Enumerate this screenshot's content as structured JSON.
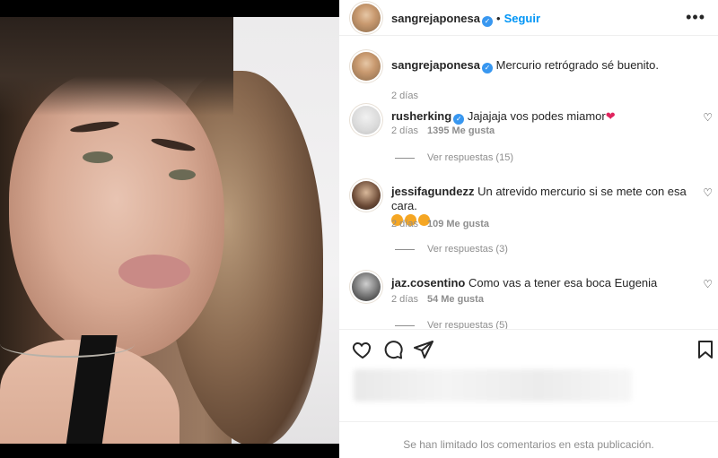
{
  "header": {
    "username": "sangrejaponesa",
    "separator": "•",
    "follow_label": "Seguir",
    "more_icon": "more-options-icon"
  },
  "caption": {
    "username": "sangrejaponesa",
    "text": "Mercurio retrógrado sé buenito.",
    "time": "2 días"
  },
  "comments": [
    {
      "username": "rusherking",
      "verified": true,
      "text": "Jajajaja vos podes miamor",
      "emoji": "red-heart",
      "time": "2 días",
      "likes": "1395 Me gusta",
      "replies": "Ver respuestas (15)"
    },
    {
      "username": "jessifagundezz",
      "verified": false,
      "text": "Un atrevido mercurio si se mete con esa cara.",
      "emoji": "heart-eyes x3",
      "time": "2 días",
      "likes": "109 Me gusta",
      "replies": "Ver respuestas (3)"
    },
    {
      "username": "jaz.cosentino",
      "verified": false,
      "text": "Como vas a tener esa boca Eugenia",
      "time": "2 días",
      "likes": "54 Me gusta",
      "replies": "Ver respuestas (5)"
    }
  ],
  "actions": {
    "like_icon": "heart-icon",
    "comment_icon": "comment-icon",
    "share_icon": "share-icon",
    "save_icon": "bookmark-icon"
  },
  "footer": {
    "limited_text": "Se han limitado los comentarios en esta publicación."
  },
  "colors": {
    "accent": "#0095f6",
    "verified": "#3897f0",
    "muted": "#8e8e8e",
    "text": "#262626"
  }
}
